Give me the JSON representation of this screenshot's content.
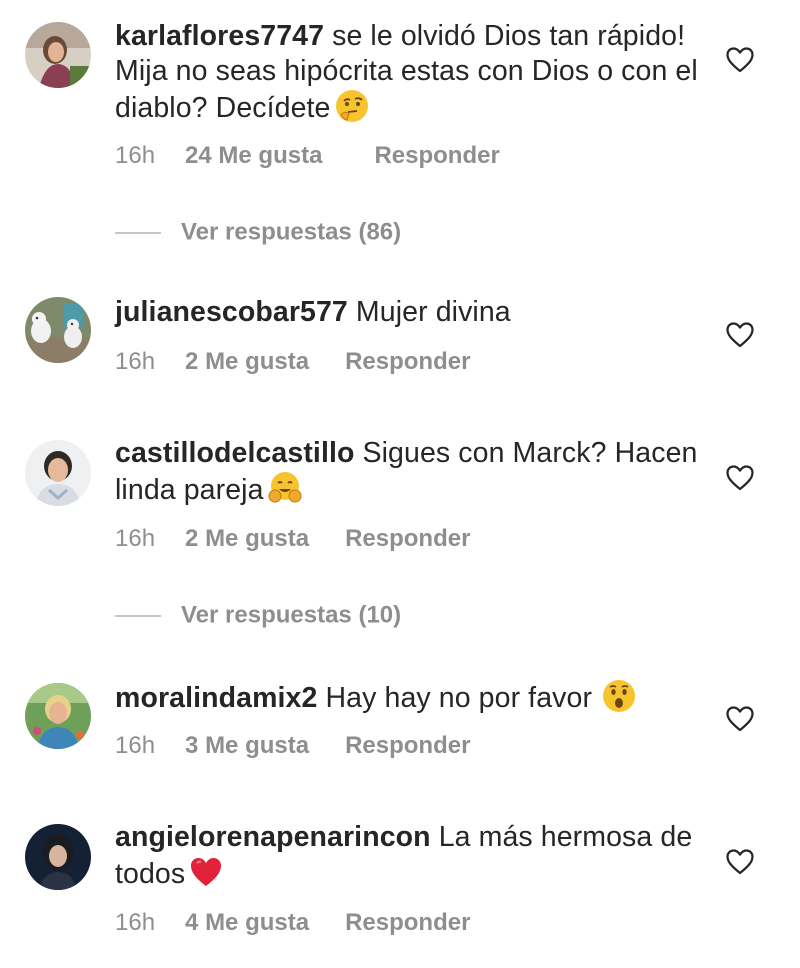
{
  "comments": [
    {
      "username": "karlaflores7747",
      "text": " se le olvidó Dios tan rápido! Mija no seas hipócrita estas con Dios o con el diablo? Decídete",
      "emoji": "thinking-face",
      "time": "16h",
      "likes": "24 Me gusta",
      "reply": "Responder"
    },
    {
      "username": "julianescobar577",
      "text": " Mujer divina",
      "time": "16h",
      "likes": "2 Me gusta",
      "reply": "Responder"
    },
    {
      "username": "castillodelcastillo",
      "text": " Sigues con Marck? Hacen linda pareja",
      "emoji": "hugging-face",
      "time": "16h",
      "likes": "2 Me gusta",
      "reply": "Responder"
    },
    {
      "username": "moralindamix2",
      "text": " Hay hay no por favor",
      "emoji": "astonished-face",
      "time": "16h",
      "likes": "3 Me gusta",
      "reply": "Responder"
    },
    {
      "username": "angielorenapenarincon",
      "text": " La más hermosa de todos",
      "emoji": "red-heart",
      "time": "16h",
      "likes": "4 Me gusta",
      "reply": "Responder"
    }
  ],
  "view_replies": [
    {
      "label": "Ver respuestas (86)"
    },
    {
      "label": "Ver respuestas (10)"
    }
  ],
  "colors": {
    "text": "#262626",
    "secondary": "#8e8e8e",
    "heart_red": "#e0223a",
    "emoji_yellow": "#f7c32e"
  }
}
